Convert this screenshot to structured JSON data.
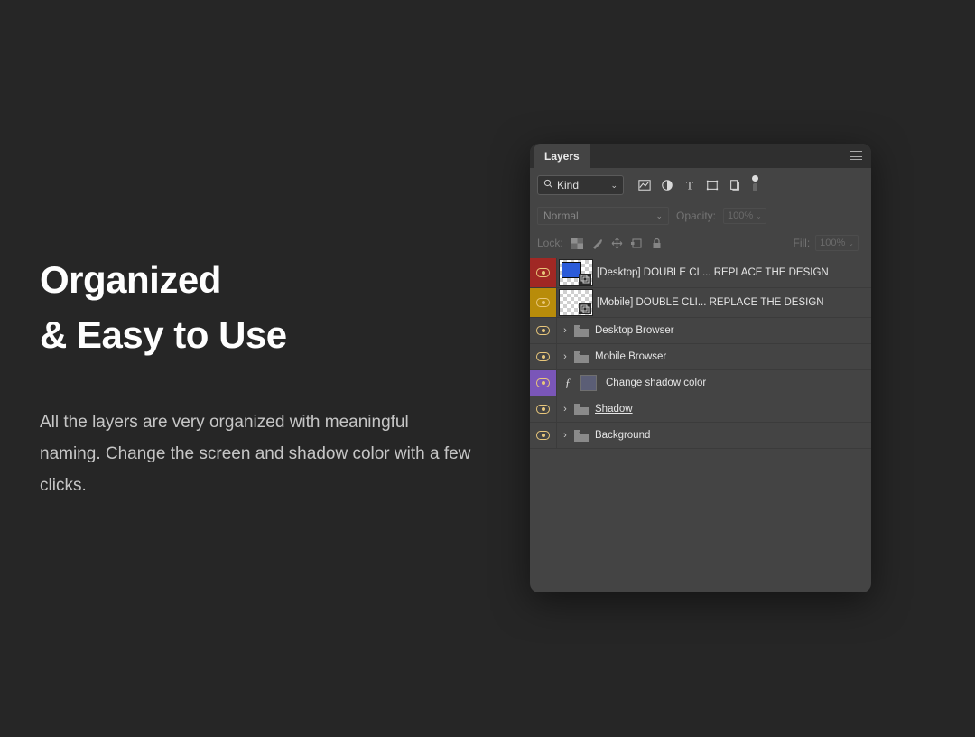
{
  "text": {
    "heading_line1": "Organized",
    "heading_line2": "& Easy to Use",
    "paragraph": "All the layers are very organized with meaningful naming. Change the screen and shadow color with a few clicks."
  },
  "panel": {
    "tab_label": "Layers",
    "kind_label": "Kind",
    "blend_mode": "Normal",
    "opacity_label": "Opacity:",
    "opacity_value": "100%",
    "lock_label": "Lock:",
    "fill_label": "Fill:",
    "fill_value": "100%"
  },
  "layers": {
    "row0": "[Desktop] DOUBLE CL... REPLACE THE DESIGN",
    "row1": "[Mobile] DOUBLE CLI... REPLACE THE DESIGN",
    "row2": "Desktop Browser",
    "row3": "Mobile Browser",
    "row4": "Change shadow color",
    "row5": "Shadow",
    "row6": "Background"
  },
  "colors": {
    "red": "#a02824",
    "yellow": "#b88c0a",
    "purple": "#7a56b8"
  }
}
